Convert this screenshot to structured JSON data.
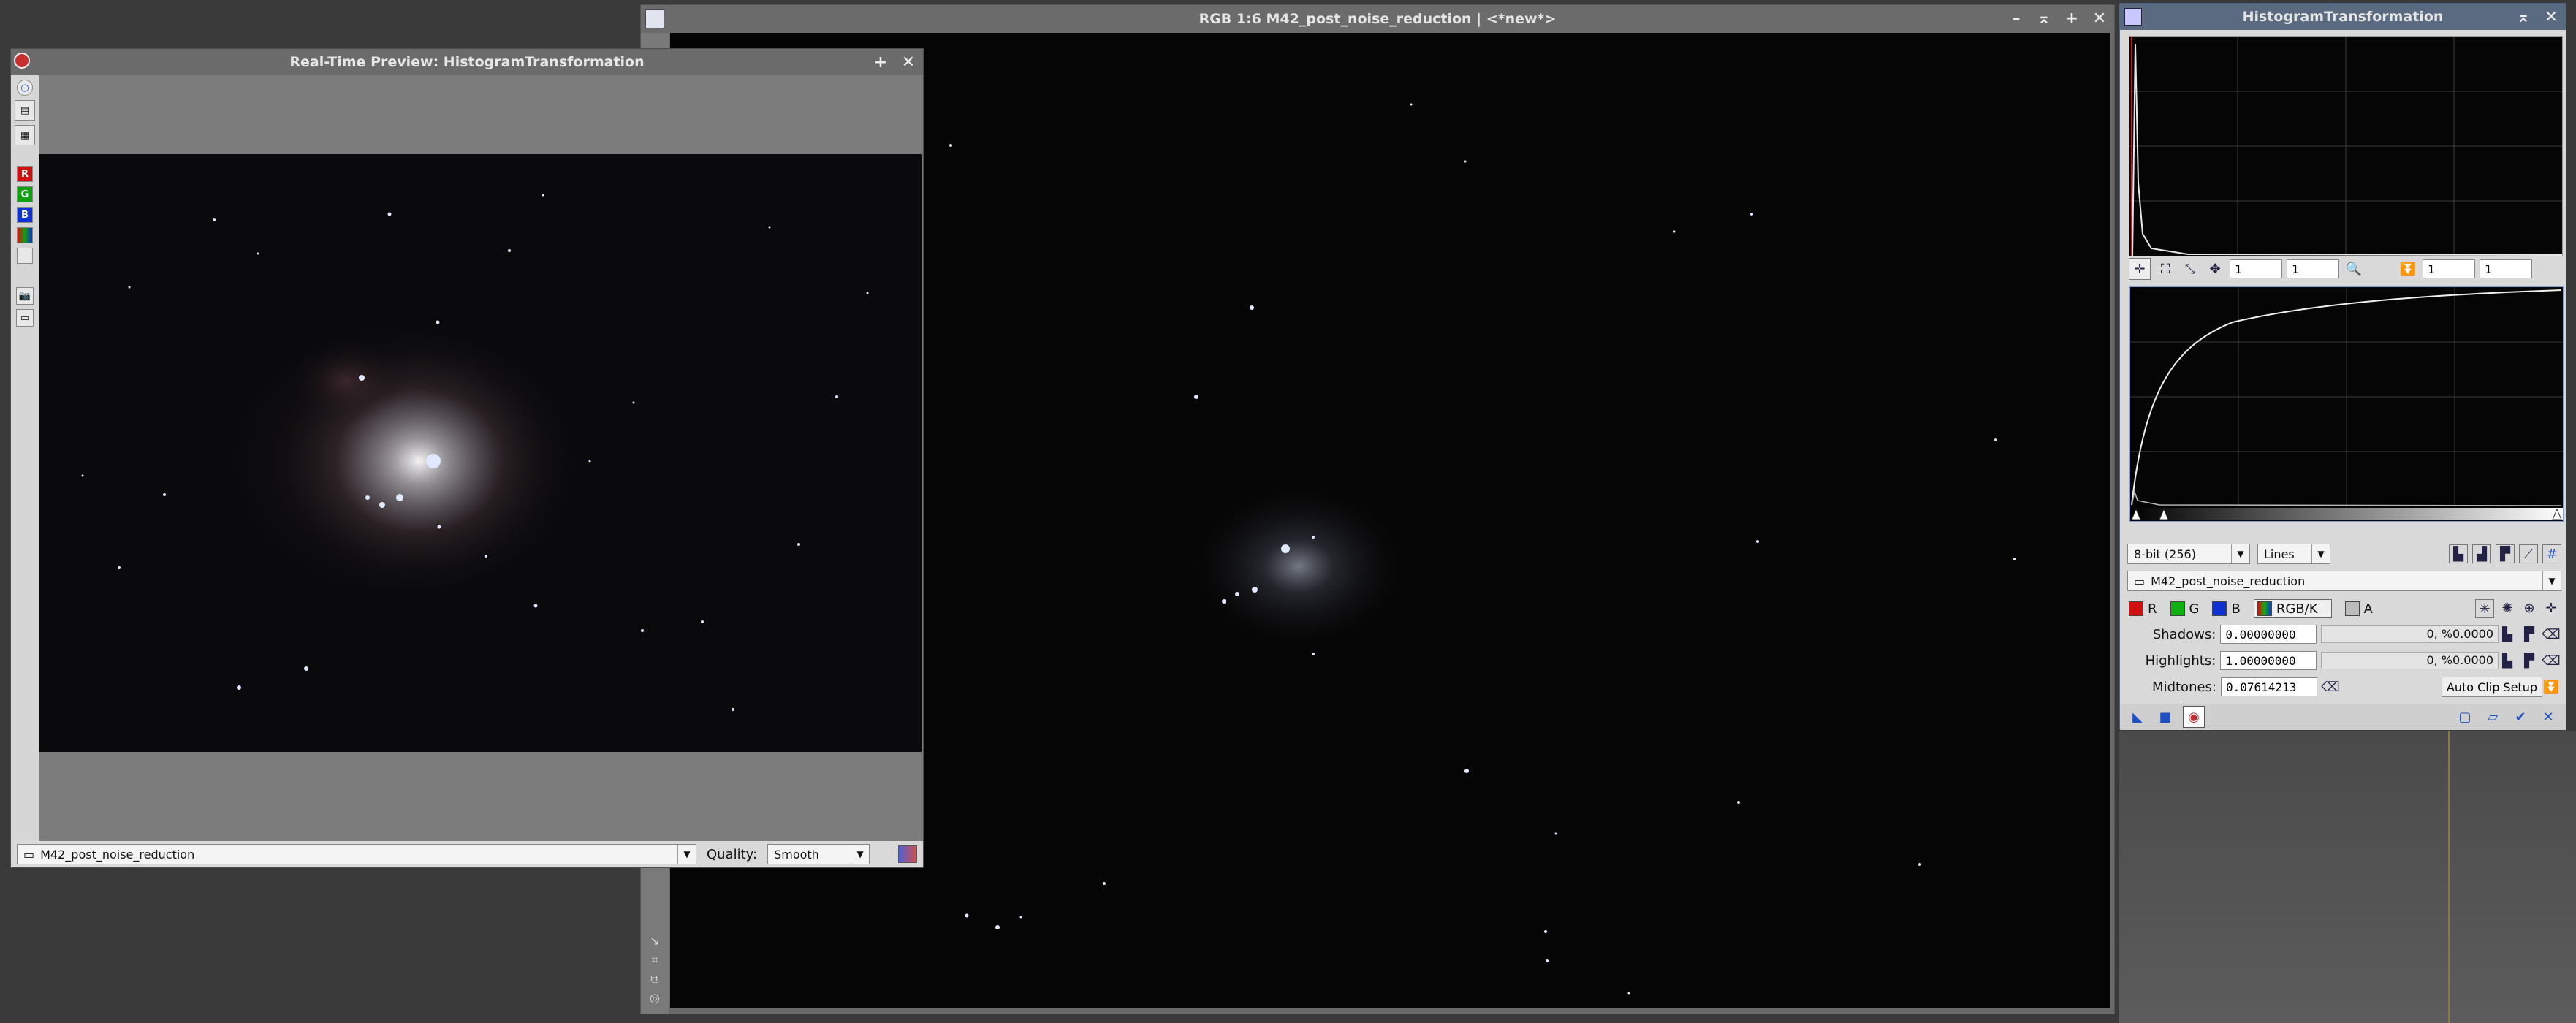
{
  "main_window": {
    "title": "RGB 1:6 M42_post_noise_reduction | <*new*>"
  },
  "preview_window": {
    "title": "Real-Time Preview: HistogramTransformation",
    "view_name": "M42_post_noise_reduction",
    "quality_label": "Quality:",
    "quality_value": "Smooth"
  },
  "ht_window": {
    "title": "HistogramTransformation",
    "zoom_fields": [
      "1",
      "1",
      "1",
      "1"
    ],
    "bit_depth": "8-bit (256)",
    "draw_mode": "Lines",
    "view_name": "M42_post_noise_reduction",
    "channels": [
      {
        "label": "R",
        "color": "#d01010"
      },
      {
        "label": "G",
        "color": "#10b010"
      },
      {
        "label": "B",
        "color": "#1030d0"
      },
      {
        "label": "RGB/K",
        "color": "#806020"
      },
      {
        "label": "A",
        "color": "#888888"
      }
    ],
    "shadows_label": "Shadows:",
    "shadows_value": "0.00000000",
    "shadows_stat": "0, %0.0000",
    "highlights_label": "Highlights:",
    "highlights_value": "1.00000000",
    "highlights_stat": "0, %0.0000",
    "midtones_label": "Midtones:",
    "midtones_value": "0.07614213",
    "auto_clip_label": "Auto Clip Setup"
  },
  "colors": {
    "desktop": "#3a3a3a",
    "image_bg": "#050505",
    "panel_bg": "#d9d9d9",
    "title_active": "#5a6a80"
  }
}
